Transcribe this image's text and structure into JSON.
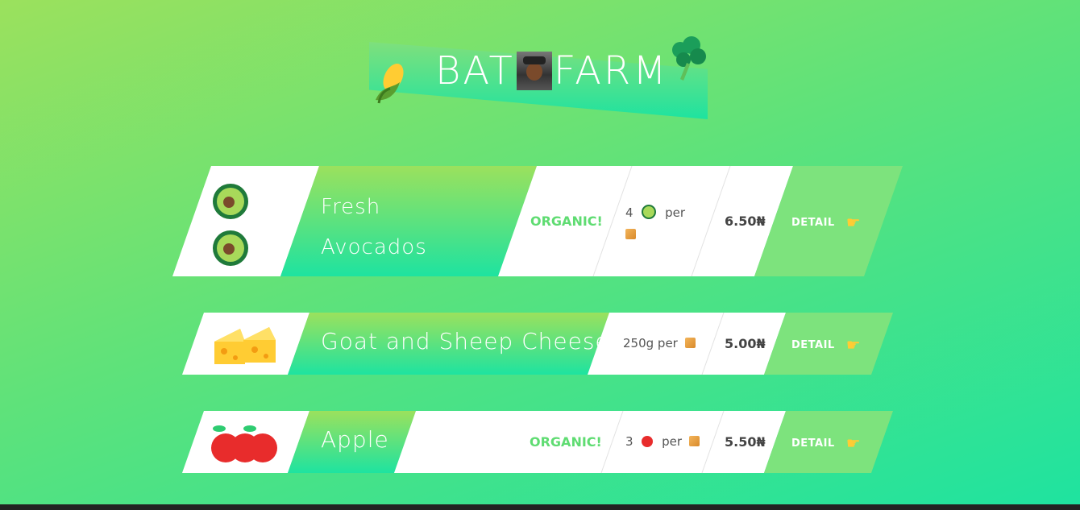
{
  "header": {
    "title_left": "BAT",
    "title_right": "FARM"
  },
  "products": [
    {
      "name_line1": "Fresh",
      "name_line2": "Avocados",
      "organic": "ORGANIC!",
      "quantity": "4",
      "per": "per",
      "price": "6.50₦",
      "detail": "DETAIL",
      "icon": "avocado-icon"
    },
    {
      "name_line1": "Goat and Sheep Cheese",
      "quantity": "250g per",
      "price": "5.00₦",
      "detail": "DETAIL",
      "icon": "cheese-icon"
    },
    {
      "name_line1": "Apple",
      "organic": "ORGANIC!",
      "quantity": "3",
      "per": "per",
      "price": "5.50₦",
      "detail": "DETAIL",
      "icon": "apple-icon"
    }
  ],
  "colors": {
    "accent_green": "#7de37d",
    "organic_green": "#5fdc72",
    "gradient_top": "#9be15d",
    "gradient_bottom": "#1ee3a0"
  }
}
